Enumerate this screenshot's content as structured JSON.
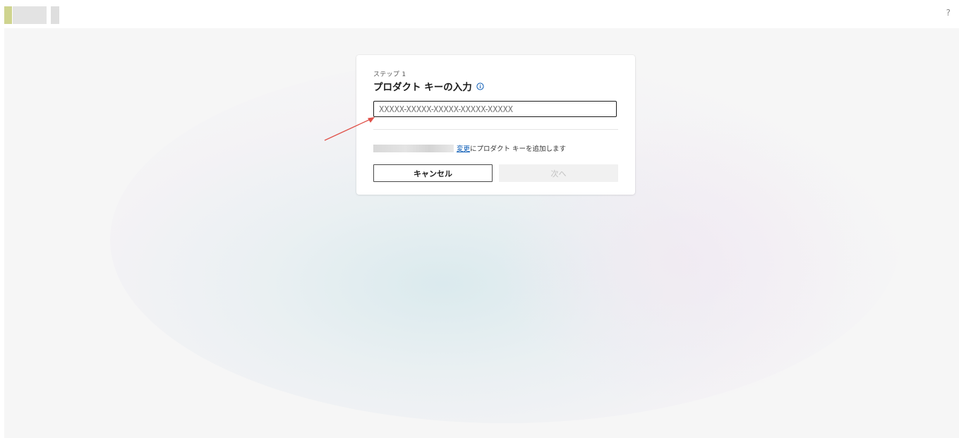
{
  "header": {
    "help_glyph": "?"
  },
  "card": {
    "step_label": "ステップ 1",
    "title": "プロダクト キーの入力",
    "product_key_input": {
      "value": "",
      "placeholder": "XXXXX-XXXXX-XXXXX-XXXXX-XXXXX"
    },
    "account_line": {
      "change_link": "変更",
      "suffix_text": "にプロダクト キーを追加します"
    },
    "cancel_button": "キャンセル",
    "next_button": "次へ",
    "next_button_enabled": false
  },
  "colors": {
    "link": "#0a5bb5",
    "annotation_arrow": "#e0524a",
    "logo_accent": "#cfd48f"
  },
  "icons": {
    "info": "info-circle-icon",
    "help": "question-mark-icon"
  }
}
